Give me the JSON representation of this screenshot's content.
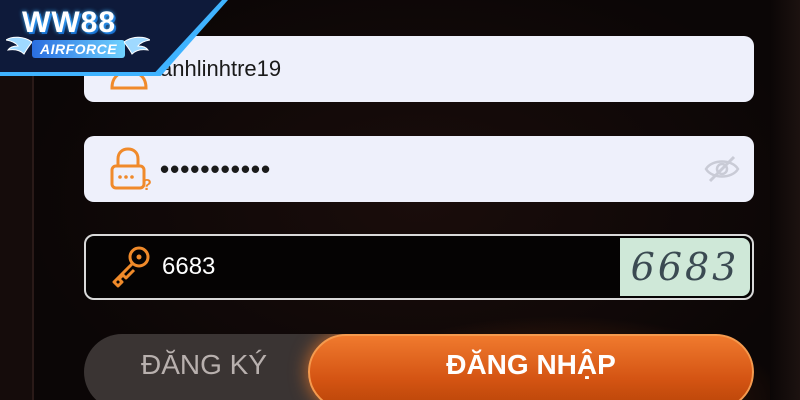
{
  "brand": {
    "logo_main": "WW88",
    "logo_sub": "AIRFORCE",
    "accent_color": "#3fb3ff"
  },
  "form": {
    "username": {
      "value": "anhlinhtre19",
      "icon": "user-icon"
    },
    "password": {
      "value": "•••••••••••",
      "icon": "lock-question-icon",
      "toggle_icon": "eye-slash-icon"
    },
    "captcha": {
      "value": "6683",
      "image_text": "6683",
      "icon": "key-icon"
    }
  },
  "buttons": {
    "register_label": "ĐĂNG KÝ",
    "login_label": "ĐĂNG NHẬP",
    "login_color": "#e0631d"
  }
}
